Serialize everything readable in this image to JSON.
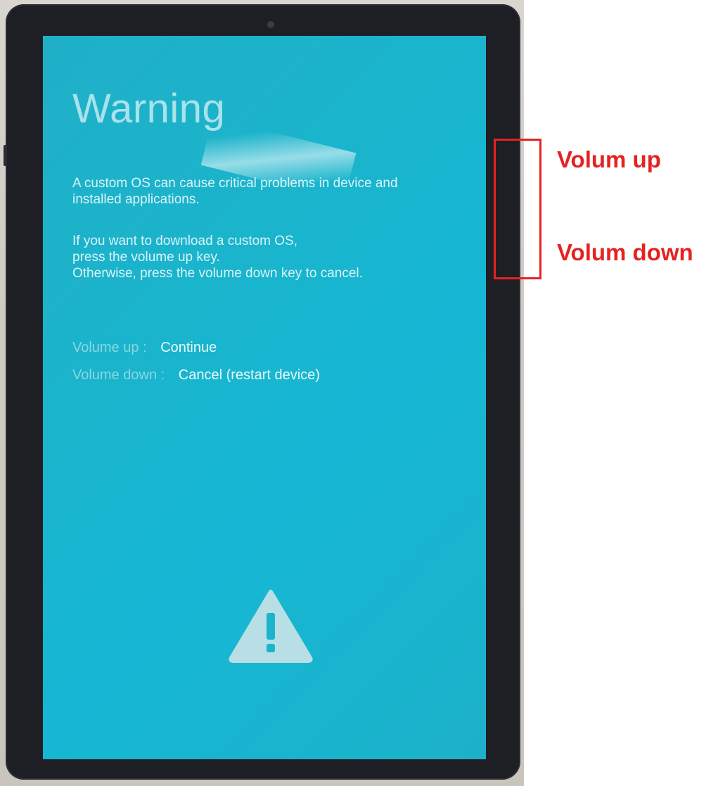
{
  "screen": {
    "title": "Warning",
    "paragraph1": "A custom OS can cause critical problems in device and\ninstalled applications.",
    "paragraph2": "If you want to download a custom OS,\npress the volume up key.\nOtherwise, press the volume down key to cancel.",
    "options": [
      {
        "key": "Volume up :",
        "action": "Continue"
      },
      {
        "key": "Volume down :",
        "action": "Cancel (restart device)"
      }
    ],
    "icon": "warning-triangle-icon"
  },
  "annotation": {
    "up_label": "Volum up",
    "down_label": "Volum down",
    "color": "#e52222"
  },
  "colors": {
    "screen_bg": "#16b7d4",
    "title": "#a9e2ea",
    "text": "#d9f4f8",
    "bezel": "#1d1f24"
  }
}
